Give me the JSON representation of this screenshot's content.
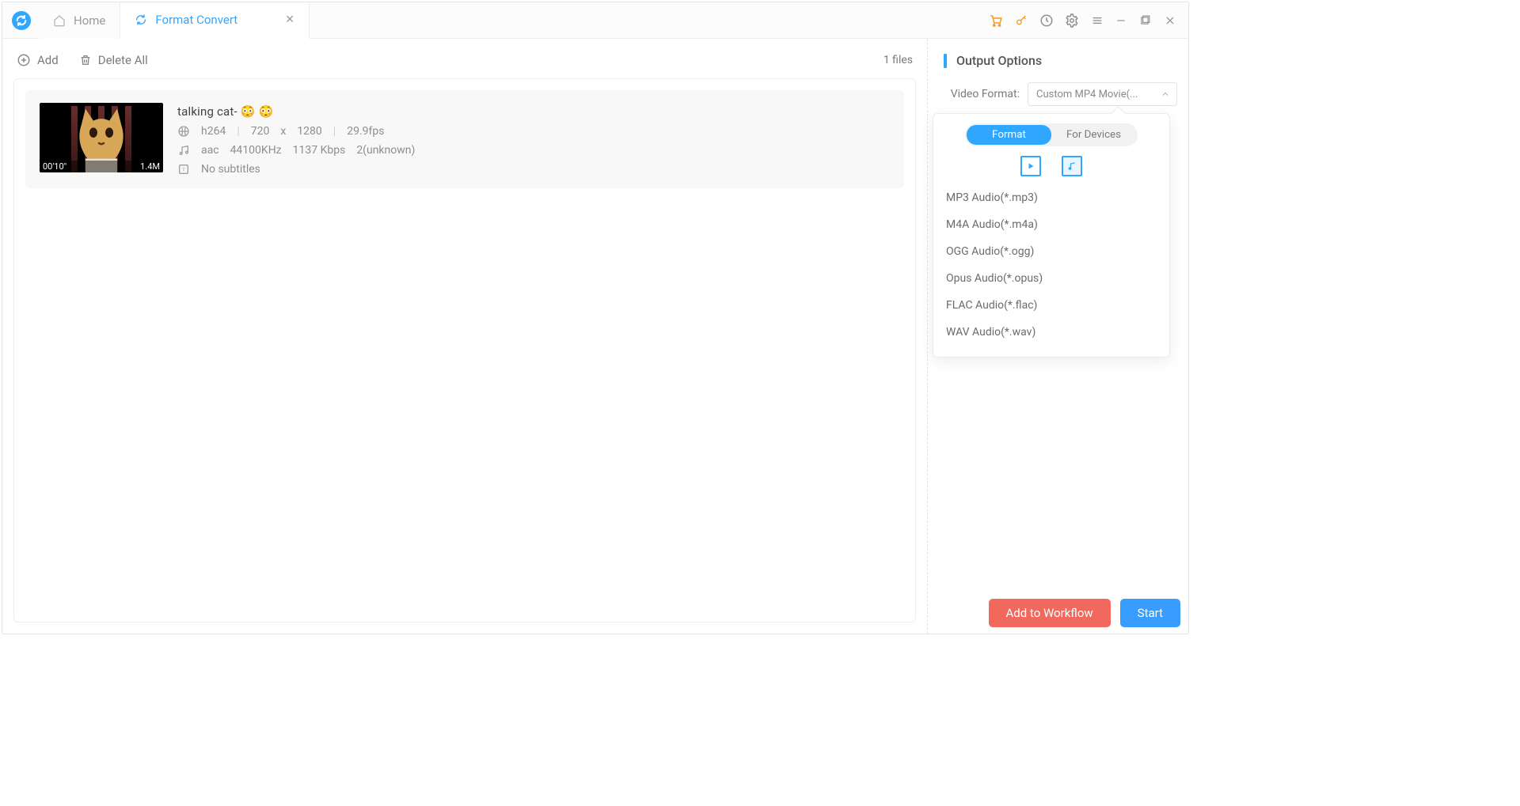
{
  "tabs": {
    "home_label": "Home",
    "convert_label": "Format Convert"
  },
  "toolbar": {
    "add_label": "Add",
    "delete_all_label": "Delete All",
    "file_count": "1 files"
  },
  "file": {
    "title": "talking cat- 😳 😳",
    "duration": "00'10\"",
    "size": "1.4M",
    "video_codec": "h264",
    "video_w": "720",
    "video_x": "x",
    "video_h": "1280",
    "video_fps": "29.9fps",
    "audio_codec": "aac",
    "audio_rate": "44100KHz",
    "audio_bitrate": "1137 Kbps",
    "audio_channels": "2(unknown)",
    "subtitles": "No subtitles"
  },
  "output": {
    "title": "Output Options",
    "video_format_label": "Video Format:",
    "video_format_value": "Custom MP4 Movie(..."
  },
  "popover": {
    "seg_format": "Format",
    "seg_devices": "For Devices",
    "formats": [
      "MP3 Audio(*.mp3)",
      "M4A Audio(*.m4a)",
      "OGG Audio(*.ogg)",
      "Opus Audio(*.opus)",
      "FLAC Audio(*.flac)",
      "WAV Audio(*.wav)"
    ]
  },
  "bottom": {
    "add_workflow": "Add to Workflow",
    "start": "Start"
  }
}
